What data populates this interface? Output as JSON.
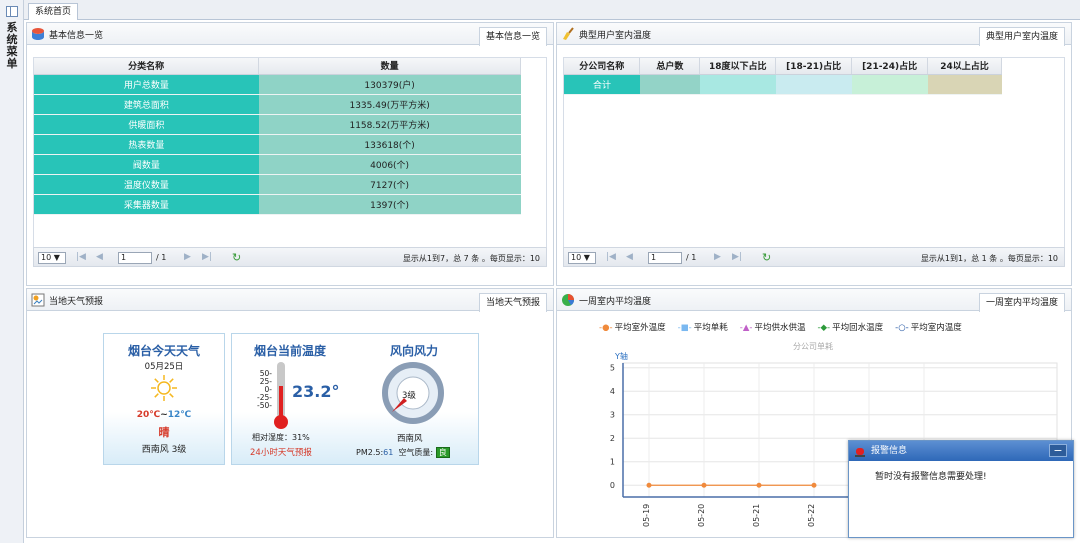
{
  "sidebar": {
    "label": "系统菜单"
  },
  "tabs": {
    "home": "系统首页"
  },
  "basic": {
    "title": "基本信息一览",
    "tab": "基本信息一览",
    "headers": [
      "分类名称",
      "数量"
    ],
    "rows": [
      [
        "用户总数量",
        "130379(户)"
      ],
      [
        "建筑总面积",
        "1335.49(万平方米)"
      ],
      [
        "供暖面积",
        "1158.52(万平方米)"
      ],
      [
        "热表数量",
        "133618(个)"
      ],
      [
        "阀数量",
        "4006(个)"
      ],
      [
        "温度仪数量",
        "7127(个)"
      ],
      [
        "采集器数量",
        "1397(个)"
      ]
    ],
    "pager": {
      "size": "10",
      "page": "1",
      "total": "/ 1",
      "info": "显示从1到7，总 7 条 。每页显示：10"
    }
  },
  "typical": {
    "title": "典型用户室内温度",
    "tab": "典型用户室内温度",
    "headers": [
      "分公司名称",
      "总户数",
      "18度以下占比",
      "[18-21)占比",
      "[21-24)占比",
      "24以上占比"
    ],
    "row_label": "合计",
    "pager": {
      "size": "10",
      "page": "1",
      "total": "/ 1",
      "info": "显示从1到1，总 1 条 。每页显示：10"
    }
  },
  "weather": {
    "title": "当地天气预报",
    "tab": "当地天气预报",
    "today": {
      "title": "烟台今天天气",
      "date": "05月25日",
      "temp_high": "20℃",
      "sep": "~",
      "temp_low": "12℃",
      "cond": "晴",
      "wind": "西南风 3级"
    },
    "current": {
      "title": "烟台当前温度",
      "value": "23.2°",
      "scale": [
        "50-",
        "25-",
        "0-",
        "-25-",
        "-50-"
      ],
      "humidity": "相对湿度：31%",
      "forecast_link": "24小时天气预报"
    },
    "wind": {
      "title": "风向风力",
      "level": "3级",
      "dir": "西南风",
      "pm_label": "PM2.5:",
      "pm_value": "61",
      "aq_label": "空气质量:",
      "aq_value": "良"
    }
  },
  "weekly": {
    "title": "一周室内平均温度",
    "tab": "一周室内平均温度",
    "legend": [
      "平均室外温度",
      "平均单耗",
      "平均供水供温",
      "平均回水温度",
      "平均室内温度"
    ],
    "subtitle": "分公司单耗",
    "ylabel": "Y轴"
  },
  "chart_data": {
    "type": "line",
    "title": "分公司单耗",
    "ylabel": "Y轴",
    "ylim": [
      -0.5,
      5.2
    ],
    "yticks": [
      0,
      1,
      2,
      3,
      4,
      5
    ],
    "categories": [
      "05-19",
      "05-20",
      "05-21",
      "05-22"
    ],
    "series": [
      {
        "name": "平均室外温度",
        "values": [
          0,
          0,
          0,
          0
        ]
      }
    ],
    "legend": [
      "平均室外温度",
      "平均单耗",
      "平均供水供温",
      "平均回水温度",
      "平均室内温度"
    ],
    "grid": true,
    "colors": {
      "平均室外温度": "#f08a3c",
      "平均单耗": "#7ab8f0",
      "平均供水供温": "#c060c8",
      "平均回水温度": "#2c9a3a",
      "平均室内温度": "#2f5fa8"
    }
  },
  "alarm": {
    "title": "报警信息",
    "btn": "−",
    "message": "暂时没有报警信息需要处理!"
  }
}
